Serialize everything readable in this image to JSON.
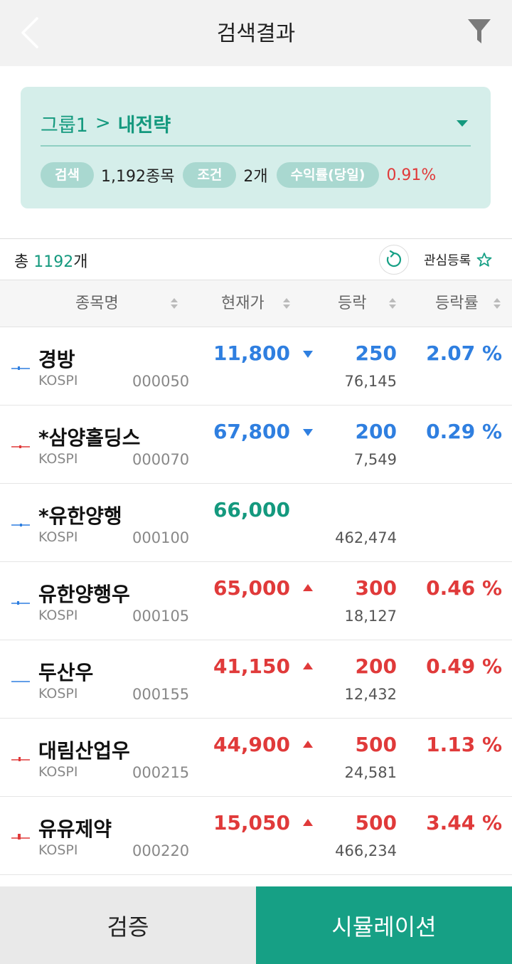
{
  "header": {
    "title": "검색결과"
  },
  "card": {
    "group": "그룹1",
    "separator": ">",
    "strategy": "내전략",
    "stats": [
      {
        "label": "검색",
        "value": "1,192종목",
        "color": "normal"
      },
      {
        "label": "조건",
        "value": "2개",
        "color": "normal"
      },
      {
        "label": "수익률(당일)",
        "value": "0.91%",
        "color": "red"
      }
    ]
  },
  "summary": {
    "total_prefix": "총",
    "total_count": "1192",
    "total_suffix": "개",
    "favorite_label": "관심등록"
  },
  "table": {
    "columns": [
      "종목명",
      "현재가",
      "등락",
      "등락률"
    ],
    "rows": [
      {
        "name": "경방",
        "market": "KOSPI",
        "code": "000050",
        "price": "11,800",
        "direction": "down",
        "change": "250",
        "volume": "76,145",
        "rate": "2.07 %"
      },
      {
        "name": "*삼양홀딩스",
        "market": "KOSPI",
        "code": "000070",
        "price": "67,800",
        "direction": "down",
        "change": "200",
        "volume": "7,549",
        "rate": "0.29 %"
      },
      {
        "name": "*유한양행",
        "market": "KOSPI",
        "code": "000100",
        "price": "66,000",
        "direction": "flat",
        "change": "",
        "volume": "462,474",
        "rate": ""
      },
      {
        "name": "유한양행우",
        "market": "KOSPI",
        "code": "000105",
        "price": "65,000",
        "direction": "up",
        "change": "300",
        "volume": "18,127",
        "rate": "0.46 %"
      },
      {
        "name": "두산우",
        "market": "KOSPI",
        "code": "000155",
        "price": "41,150",
        "direction": "up",
        "change": "200",
        "volume": "12,432",
        "rate": "0.49 %"
      },
      {
        "name": "대림산업우",
        "market": "KOSPI",
        "code": "000215",
        "price": "44,900",
        "direction": "up",
        "change": "500",
        "volume": "24,581",
        "rate": "1.13 %"
      },
      {
        "name": "유유제약",
        "market": "KOSPI",
        "code": "000220",
        "price": "15,050",
        "direction": "up",
        "change": "500",
        "volume": "466,234",
        "rate": "3.44 %"
      }
    ]
  },
  "colors": {
    "up": "#e03a3a",
    "down": "#2f7fe0",
    "flat": "#14997e",
    "accent": "#16a085"
  },
  "buttons": {
    "verify": "검증",
    "simulation": "시뮬레이션"
  }
}
